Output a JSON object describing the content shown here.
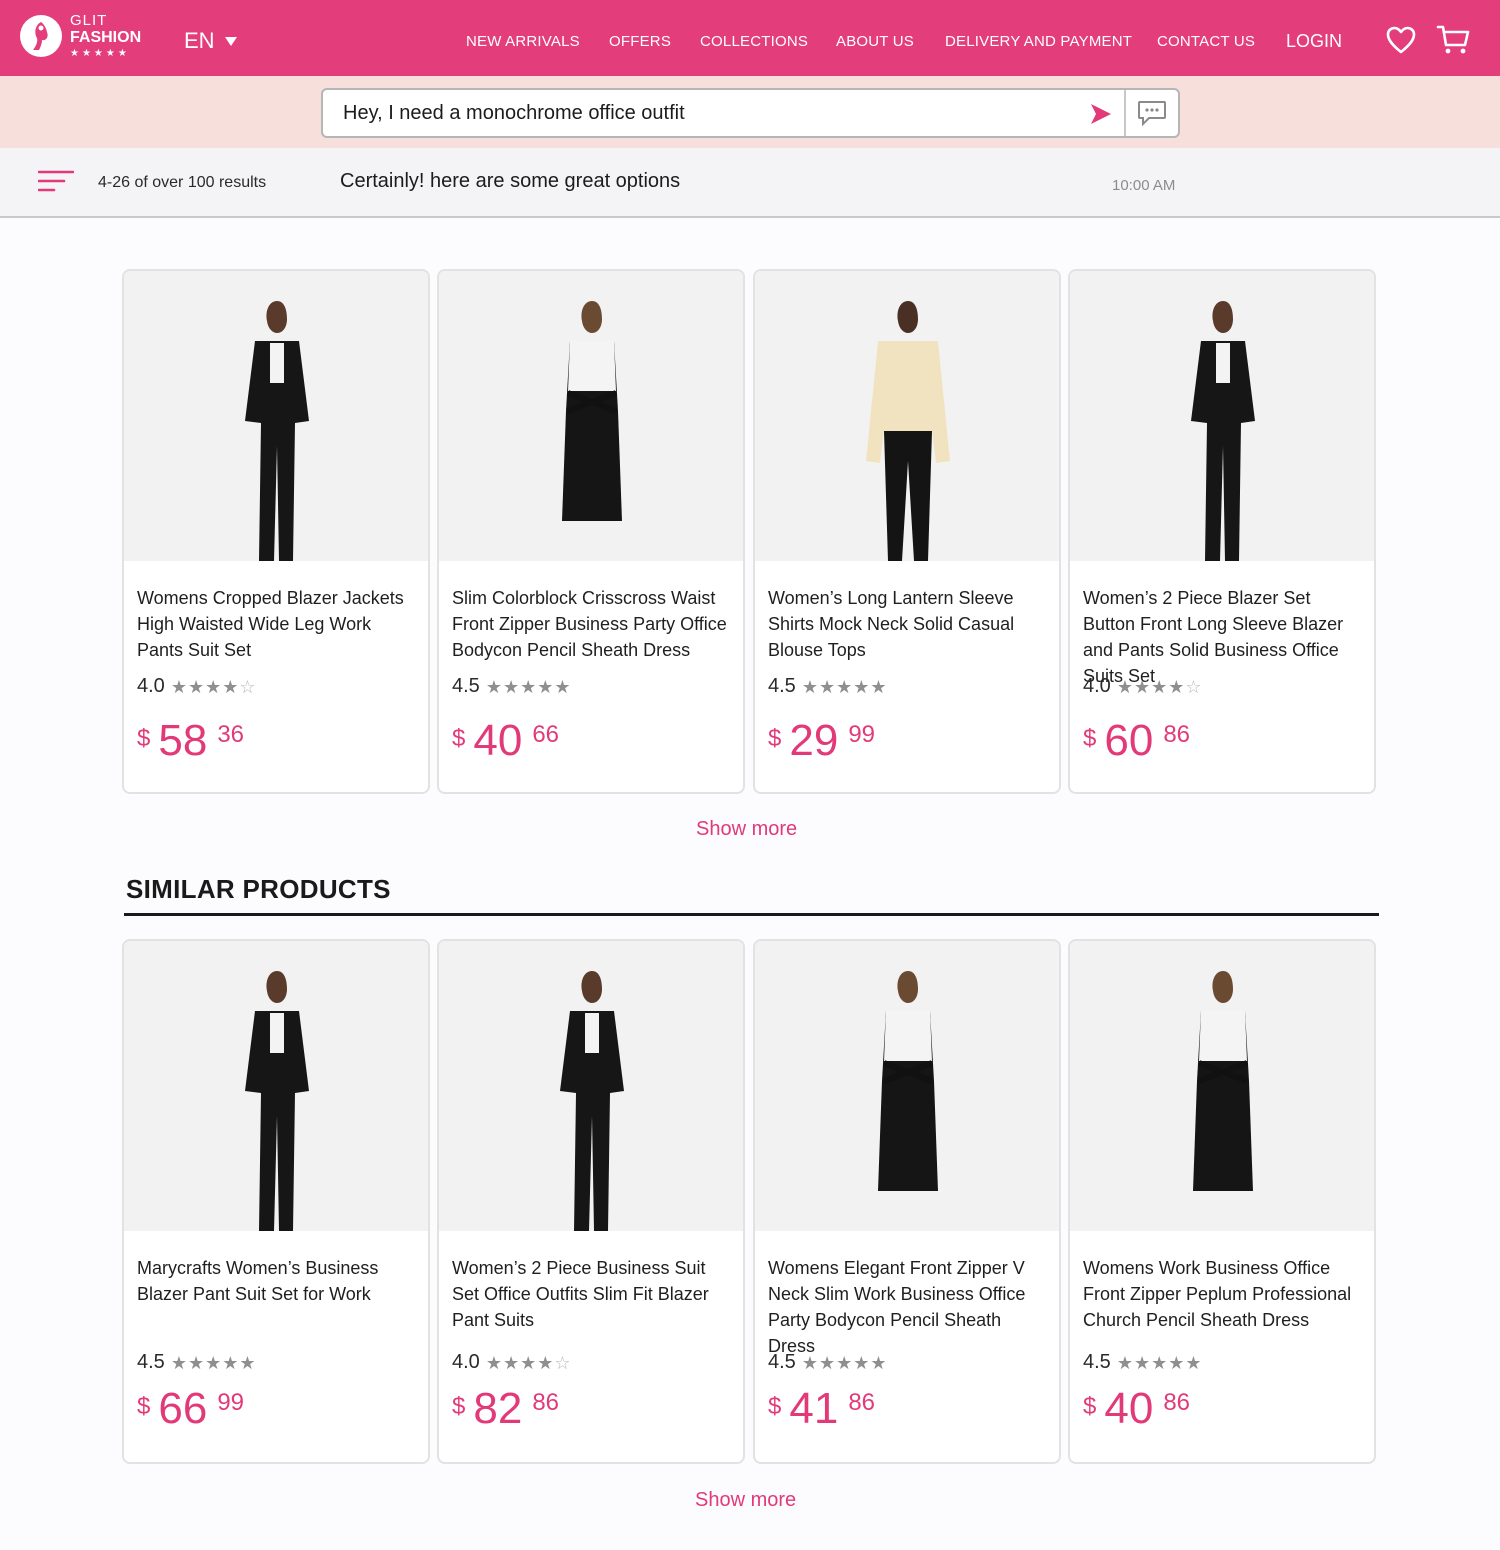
{
  "brand": {
    "line1": "GLIT",
    "line2": "FASHION",
    "stars": "★★★★★"
  },
  "language": {
    "label": "EN"
  },
  "nav": [
    {
      "label": "NEW ARRIVALS"
    },
    {
      "label": "OFFERS"
    },
    {
      "label": "COLLECTIONS"
    },
    {
      "label": "ABOUT US"
    },
    {
      "label": "DELIVERY AND PAYMENT"
    },
    {
      "label": "CONTACT US"
    }
  ],
  "login_label": "LOGIN",
  "icons": {
    "wishlist": "heart-icon",
    "cart": "cart-icon",
    "send": "send-icon",
    "chat": "chat-bubble-icon",
    "filter": "filter-icon"
  },
  "chat": {
    "query": "Hey, I need a monochrome office outfit"
  },
  "results": {
    "count": "4-26 of over 100 results",
    "reply": "Certainly! here are some great options",
    "time": "10:00 AM"
  },
  "colors": {
    "brand_pink": "#e33d7c",
    "price_pink": "#e23a79",
    "chat_band": "#f7dfdc"
  },
  "products": [
    {
      "title": "Womens Cropped Blazer Jackets High Waisted Wide Leg Work Pants Suit Set",
      "rating": "4.0",
      "stars": 4,
      "currency": "$",
      "price_int": "58",
      "price_dec": "36"
    },
    {
      "title": "Slim Colorblock Crisscross Waist Front Zipper Business Party Office Bodycon Pencil Sheath Dress",
      "rating": "4.5",
      "stars": 4.5,
      "currency": "$",
      "price_int": "40",
      "price_dec": "66"
    },
    {
      "title": "Women’s Long Lantern Sleeve Shirts Mock Neck Solid Casual Blouse Tops",
      "rating": "4.5",
      "stars": 4.5,
      "currency": "$",
      "price_int": "29",
      "price_dec": "99"
    },
    {
      "title": "Women’s 2 Piece Blazer Set Button Front Long Sleeve Blazer and Pants Solid Business Office Suits Set",
      "rating": "4.0",
      "stars": 4,
      "currency": "$",
      "price_int": "60",
      "price_dec": "86"
    }
  ],
  "show_more_label": "Show more",
  "similar": {
    "title": "SIMILAR PRODUCTS",
    "products": [
      {
        "title": "Marycrafts Women’s Business Blazer Pant Suit Set for Work",
        "rating": "4.5",
        "stars": 4.5,
        "currency": "$",
        "price_int": "66",
        "price_dec": "99"
      },
      {
        "title": "Women’s 2 Piece Business Suit Set Office Outfits Slim Fit Blazer Pant Suits",
        "rating": "4.0",
        "stars": 4,
        "currency": "$",
        "price_int": "82",
        "price_dec": "86"
      },
      {
        "title": "Womens Elegant Front Zipper V Neck Slim Work Business Office Party Bodycon Pencil Sheath Dress",
        "rating": "4.5",
        "stars": 4.5,
        "currency": "$",
        "price_int": "41",
        "price_dec": "86"
      },
      {
        "title": "Womens Work Business Office Front Zipper Peplum Professional Church Pencil Sheath Dress",
        "rating": "4.5",
        "stars": 4.5,
        "currency": "$",
        "price_int": "40",
        "price_dec": "86"
      }
    ],
    "show_more_label": "Show more"
  }
}
